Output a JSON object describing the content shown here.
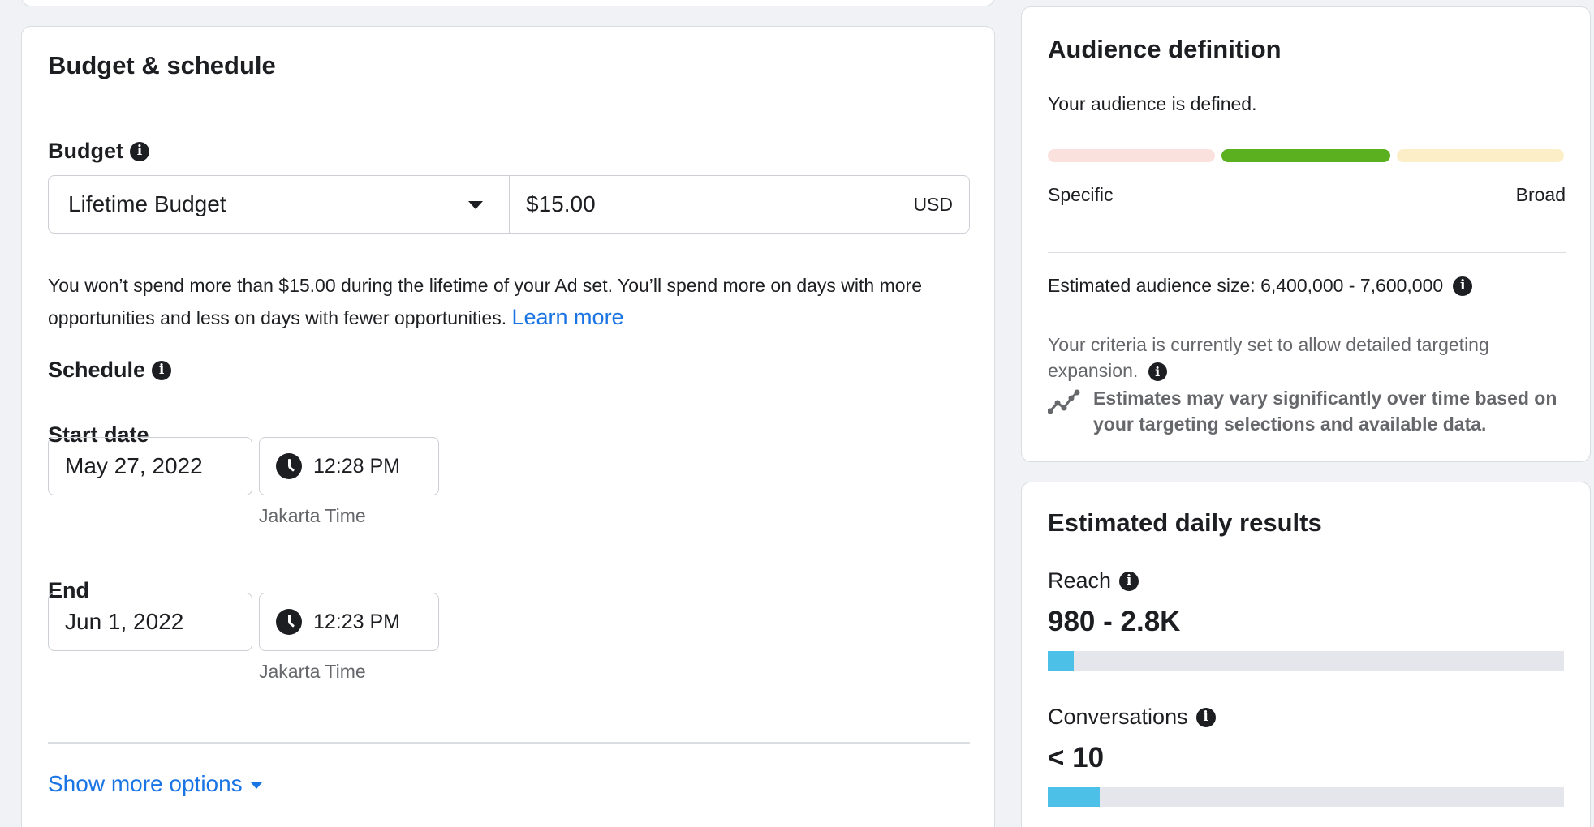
{
  "budget_schedule": {
    "title": "Budget & schedule",
    "budget_label": "Budget",
    "budget_type": "Lifetime Budget",
    "budget_amount": "$15.00",
    "currency": "USD",
    "help_text": "You won’t spend more than $15.00 during the lifetime of your Ad set. You’ll spend more on days with more opportunities and less on days with fewer opportunities.",
    "learn_more": "Learn more",
    "schedule_label": "Schedule",
    "start_label": "Start date",
    "start_date": "May 27, 2022",
    "start_time": "12:28 PM",
    "start_tz": "Jakarta Time",
    "end_label": "End",
    "end_date": "Jun 1, 2022",
    "end_time": "12:23 PM",
    "end_tz": "Jakarta Time",
    "show_more": "Show more options"
  },
  "audience": {
    "title": "Audience definition",
    "status": "Your audience is defined.",
    "meter_colors": [
      "#fbe1dd",
      "#5ab01f",
      "#fcefc8"
    ],
    "specific_label": "Specific",
    "broad_label": "Broad",
    "size_label": "Estimated audience size: 6,400,000 - 7,600,000",
    "criteria_text": "Your criteria is currently set to allow detailed targeting expansion.",
    "estimate_note": "Estimates may vary significantly over time based on your targeting selections and available data."
  },
  "results": {
    "title": "Estimated daily results",
    "reach_label": "Reach",
    "reach_value": "980 - 2.8K",
    "reach_fill": 0.05,
    "conversations_label": "Conversations",
    "conversations_value": "< 10",
    "conversations_fill": 0.1,
    "bar_color": "#4dc0e8"
  }
}
